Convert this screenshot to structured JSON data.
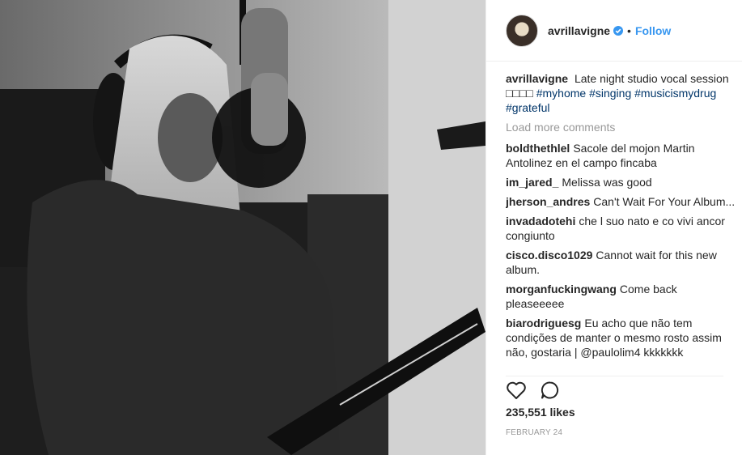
{
  "post": {
    "username": "avrillavigne",
    "follow_label": "Follow",
    "separator": "•",
    "caption_user": "avrillavigne",
    "caption_text": "Late night studio vocal session □□□□",
    "caption_tags": [
      "#myhome",
      "#singing",
      "#musicismydrug",
      "#grateful"
    ],
    "load_more": "Load more comments",
    "comments": [
      {
        "user": "boldthethlel",
        "text": "Sacole del mojon Martin Antolinez en el campo fincaba"
      },
      {
        "user": "im_jared_",
        "text": "Melissa was good"
      },
      {
        "user": "jherson_andres",
        "text": "Can't Wait For Your Album..."
      },
      {
        "user": "invadadotehi",
        "text": "che l suo nato e co vivi ancor congiunto"
      },
      {
        "user": "cisco.disco1029",
        "text": "Cannot wait for this new album."
      },
      {
        "user": "morganfuckingwang",
        "text": "Come back pleaseeeee"
      },
      {
        "user": "biarodriguesg",
        "text": "Eu acho que não tem condições de manter o mesmo rosto assim não, gostaria | @paulolim4 kkkkkkk"
      }
    ],
    "likes": "235,551 likes",
    "date": "FEBRUARY 24"
  },
  "icons": {
    "verified": "verified-badge-icon",
    "like": "heart-icon",
    "comment": "comment-bubble-icon"
  },
  "colors": {
    "link": "#3897f0",
    "hashtag": "#003569",
    "muted": "#999999",
    "text": "#262626"
  }
}
